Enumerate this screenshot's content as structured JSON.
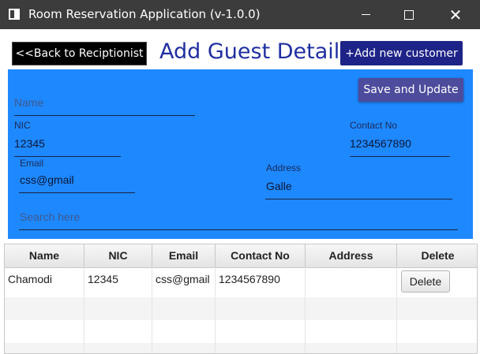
{
  "window": {
    "title": "Room Reservation Application (v-1.0.0)"
  },
  "header": {
    "back_label": "<<Back to Reciptionist",
    "page_title": "Add Guest Details",
    "add_label": "+Add new customer"
  },
  "form": {
    "save_label": "Save and Update",
    "name_placeholder": "Name",
    "nic_label": "NIC",
    "nic_value": "12345",
    "contact_label": "Contact No",
    "contact_value": "1234567890",
    "email_label": "Email",
    "email_value": "css@gmail",
    "address_label": "Address",
    "address_value": "Galle",
    "search_placeholder": "Search here"
  },
  "table": {
    "columns": [
      "Name",
      "NIC",
      "Email",
      "Contact No",
      "Address",
      "Delete"
    ],
    "rows": [
      {
        "name": "Chamodi",
        "nic": "12345",
        "email": "css@gmail",
        "contact": "1234567890",
        "address": "",
        "delete_label": "Delete"
      }
    ]
  },
  "colors": {
    "panel": "#1e88ff",
    "title_text": "#1f2fa0",
    "add_button": "#1e2487",
    "save_button": "#4d4b9c"
  }
}
